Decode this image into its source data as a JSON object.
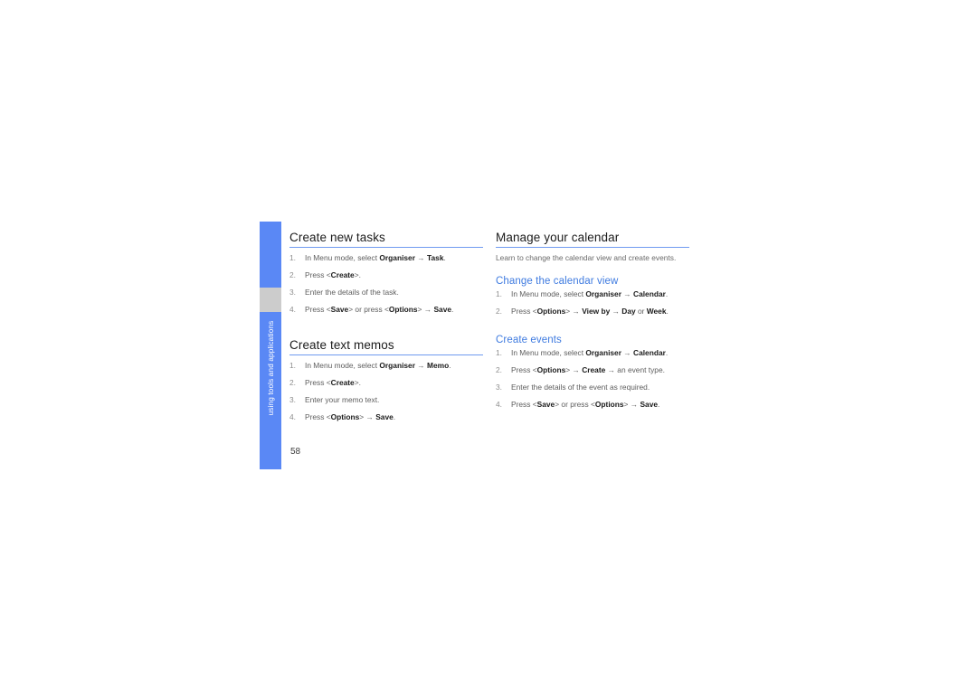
{
  "page": {
    "number": "58",
    "side_tab_label": "using tools and applications",
    "accent_blue": "#5a88f5",
    "heading_blue": "#3f7be0",
    "rule_blue": "#6f9bf0",
    "tab_gap_gray": "#cccccc"
  },
  "left_column": {
    "sections": [
      {
        "heading": "Create new tasks",
        "steps": [
          {
            "num": "1.",
            "parts": [
              {
                "t": "In Menu mode, select ",
                "b": false
              },
              {
                "t": "Organiser",
                "b": true
              },
              {
                "t": " → ",
                "b": false
              },
              {
                "t": "Task",
                "b": true
              },
              {
                "t": ".",
                "b": false
              }
            ]
          },
          {
            "num": "2.",
            "parts": [
              {
                "t": "Press <",
                "b": false
              },
              {
                "t": "Create",
                "b": true
              },
              {
                "t": ">.",
                "b": false
              }
            ]
          },
          {
            "num": "3.",
            "parts": [
              {
                "t": "Enter the details of the task.",
                "b": false
              }
            ]
          },
          {
            "num": "4.",
            "parts": [
              {
                "t": "Press <",
                "b": false
              },
              {
                "t": "Save",
                "b": true
              },
              {
                "t": "> or press <",
                "b": false
              },
              {
                "t": "Options",
                "b": true
              },
              {
                "t": "> → ",
                "b": false
              },
              {
                "t": "Save",
                "b": true
              },
              {
                "t": ".",
                "b": false
              }
            ]
          }
        ]
      },
      {
        "heading": "Create text memos",
        "steps": [
          {
            "num": "1.",
            "parts": [
              {
                "t": "In Menu mode, select ",
                "b": false
              },
              {
                "t": "Organiser",
                "b": true
              },
              {
                "t": " → ",
                "b": false
              },
              {
                "t": "Memo",
                "b": true
              },
              {
                "t": ".",
                "b": false
              }
            ]
          },
          {
            "num": "2.",
            "parts": [
              {
                "t": "Press <",
                "b": false
              },
              {
                "t": "Create",
                "b": true
              },
              {
                "t": ">.",
                "b": false
              }
            ]
          },
          {
            "num": "3.",
            "parts": [
              {
                "t": "Enter your memo text.",
                "b": false
              }
            ]
          },
          {
            "num": "4.",
            "parts": [
              {
                "t": "Press <",
                "b": false
              },
              {
                "t": "Options",
                "b": true
              },
              {
                "t": "> → ",
                "b": false
              },
              {
                "t": "Save",
                "b": true
              },
              {
                "t": ".",
                "b": false
              }
            ]
          }
        ]
      }
    ]
  },
  "right_column": {
    "heading": "Manage your calendar",
    "intro": "Learn to change the calendar view and create events.",
    "subsections": [
      {
        "heading": "Change the calendar view",
        "steps": [
          {
            "num": "1.",
            "parts": [
              {
                "t": "In Menu mode, select ",
                "b": false
              },
              {
                "t": "Organiser",
                "b": true
              },
              {
                "t": " → ",
                "b": false
              },
              {
                "t": "Calendar",
                "b": true
              },
              {
                "t": ".",
                "b": false
              }
            ]
          },
          {
            "num": "2.",
            "parts": [
              {
                "t": "Press <",
                "b": false
              },
              {
                "t": "Options",
                "b": true
              },
              {
                "t": "> → ",
                "b": false
              },
              {
                "t": "View by",
                "b": true
              },
              {
                "t": " → ",
                "b": false
              },
              {
                "t": "Day",
                "b": true
              },
              {
                "t": " or ",
                "b": false
              },
              {
                "t": "Week",
                "b": true
              },
              {
                "t": ".",
                "b": false
              }
            ]
          }
        ]
      },
      {
        "heading": "Create events",
        "steps": [
          {
            "num": "1.",
            "parts": [
              {
                "t": "In Menu mode, select ",
                "b": false
              },
              {
                "t": "Organiser",
                "b": true
              },
              {
                "t": " → ",
                "b": false
              },
              {
                "t": "Calendar",
                "b": true
              },
              {
                "t": ".",
                "b": false
              }
            ]
          },
          {
            "num": "2.",
            "parts": [
              {
                "t": "Press <",
                "b": false
              },
              {
                "t": "Options",
                "b": true
              },
              {
                "t": "> → ",
                "b": false
              },
              {
                "t": "Create",
                "b": true
              },
              {
                "t": " → an event type.",
                "b": false
              }
            ]
          },
          {
            "num": "3.",
            "parts": [
              {
                "t": "Enter the details of the event as required.",
                "b": false
              }
            ]
          },
          {
            "num": "4.",
            "parts": [
              {
                "t": "Press <",
                "b": false
              },
              {
                "t": "Save",
                "b": true
              },
              {
                "t": "> or press <",
                "b": false
              },
              {
                "t": "Options",
                "b": true
              },
              {
                "t": "> → ",
                "b": false
              },
              {
                "t": "Save",
                "b": true
              },
              {
                "t": ".",
                "b": false
              }
            ]
          }
        ]
      }
    ]
  }
}
